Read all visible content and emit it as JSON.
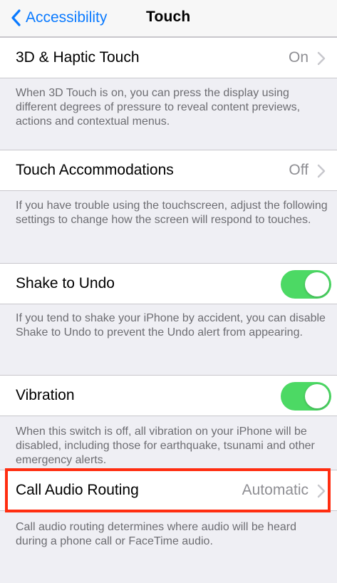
{
  "nav": {
    "back_label": "Accessibility",
    "title": "Touch"
  },
  "sections": [
    {
      "label": "3D & Haptic Touch",
      "value": "On",
      "footer": "When 3D Touch is on, you can press the display using different degrees of pressure to reveal content previews, actions and contextual menus."
    },
    {
      "label": "Touch Accommodations",
      "value": "Off",
      "footer": "If you have trouble using the touchscreen, adjust the following settings to change how the screen will respond to touches."
    },
    {
      "label": "Shake to Undo",
      "toggle_on": true,
      "footer": "If you tend to shake your iPhone by accident, you can disable Shake to Undo to prevent the Undo alert from appearing."
    },
    {
      "label": "Vibration",
      "toggle_on": true,
      "footer": "When this switch is off, all vibration on your iPhone will be disabled, including those for earthquake, tsunami and other emergency alerts."
    },
    {
      "label": "Call Audio Routing",
      "value": "Automatic",
      "footer": "Call audio routing determines where audio will be heard during a phone call or FaceTime audio."
    }
  ],
  "colors": {
    "accent": "#0a7aff",
    "toggle_on": "#4cd964",
    "highlight": "#ff2d10"
  },
  "icons": {
    "back": "chevron-left-icon",
    "disclosure": "chevron-right-icon"
  }
}
